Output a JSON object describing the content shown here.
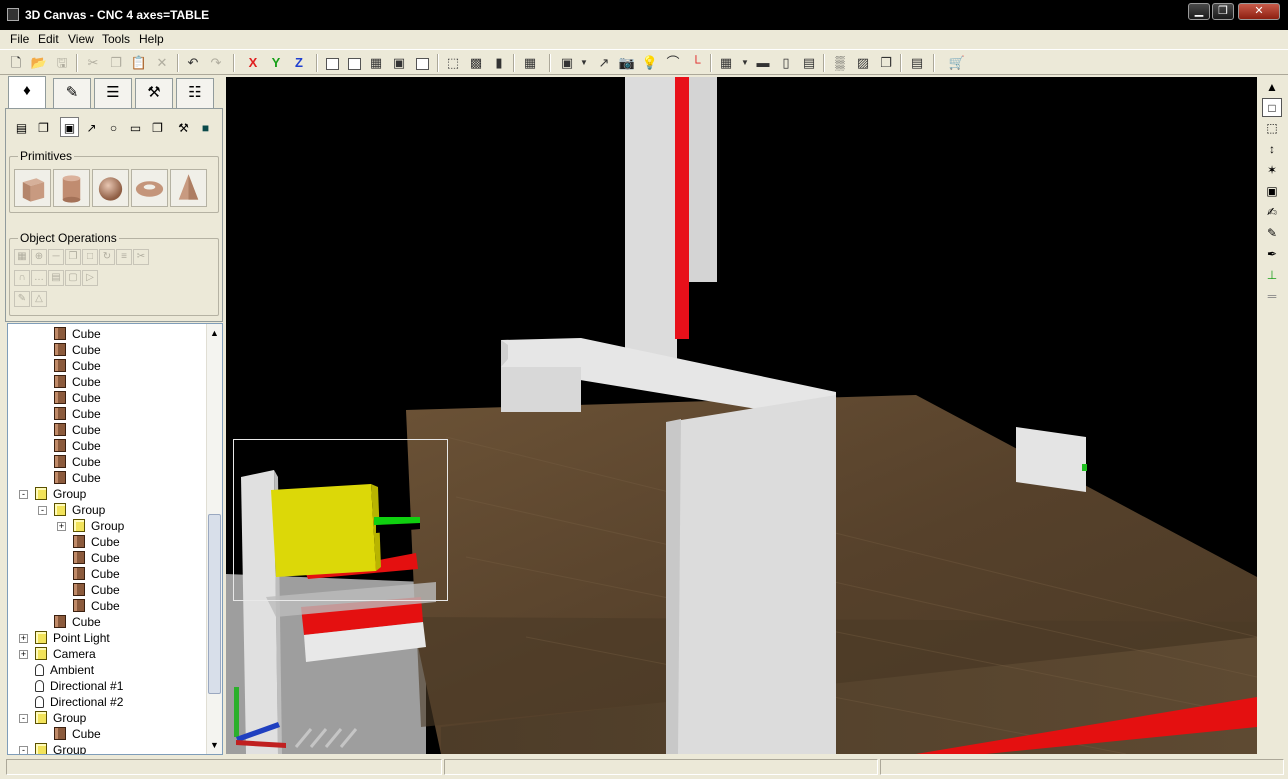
{
  "window": {
    "title": "3D Canvas - CNC 4 axes=TABLE"
  },
  "menu": [
    "File",
    "Edit",
    "View",
    "Tools",
    "Help"
  ],
  "toolbar": {
    "x_label": "X",
    "y_label": "Y",
    "z_label": "Z"
  },
  "panel": {
    "primitives_title": "Primitives",
    "operations_title": "Object Operations"
  },
  "tree": {
    "rows": [
      {
        "label": "Cube",
        "type": "cube",
        "depth": 2
      },
      {
        "label": "Cube",
        "type": "cube",
        "depth": 2
      },
      {
        "label": "Cube",
        "type": "cube",
        "depth": 2
      },
      {
        "label": "Cube",
        "type": "cube",
        "depth": 2
      },
      {
        "label": "Cube",
        "type": "cube",
        "depth": 2
      },
      {
        "label": "Cube",
        "type": "cube",
        "depth": 2
      },
      {
        "label": "Cube",
        "type": "cube",
        "depth": 2
      },
      {
        "label": "Cube",
        "type": "cube",
        "depth": 2
      },
      {
        "label": "Cube",
        "type": "cube",
        "depth": 2
      },
      {
        "label": "Cube",
        "type": "cube",
        "depth": 2
      },
      {
        "label": "Group",
        "type": "group",
        "depth": 1,
        "toggle": "-"
      },
      {
        "label": "Group",
        "type": "group",
        "depth": 2,
        "toggle": "-"
      },
      {
        "label": "Group",
        "type": "group",
        "depth": 3,
        "toggle": "+"
      },
      {
        "label": "Cube",
        "type": "cube",
        "depth": 3
      },
      {
        "label": "Cube",
        "type": "cube",
        "depth": 3
      },
      {
        "label": "Cube",
        "type": "cube",
        "depth": 3
      },
      {
        "label": "Cube",
        "type": "cube",
        "depth": 3
      },
      {
        "label": "Cube",
        "type": "cube",
        "depth": 3
      },
      {
        "label": "Cube",
        "type": "cube",
        "depth": 2
      },
      {
        "label": "Point Light",
        "type": "group",
        "depth": 1,
        "toggle": "+"
      },
      {
        "label": "Camera",
        "type": "group",
        "depth": 1,
        "toggle": "+"
      },
      {
        "label": "Ambient",
        "type": "light",
        "depth": 1
      },
      {
        "label": "Directional #1",
        "type": "light",
        "depth": 1
      },
      {
        "label": "Directional #2",
        "type": "light",
        "depth": 1
      },
      {
        "label": "Group",
        "type": "group",
        "depth": 1,
        "toggle": "-"
      },
      {
        "label": "Cube",
        "type": "cube",
        "depth": 2
      },
      {
        "label": "Group",
        "type": "group",
        "depth": 1,
        "toggle": "-"
      }
    ]
  },
  "colors": {
    "viewport_bg": "#000000",
    "table_wood": "#5a4630",
    "frame_white": "#e2e2e2",
    "accent_red": "#e01010",
    "accent_green": "#10d010",
    "tool_yellow": "#dcd808"
  }
}
